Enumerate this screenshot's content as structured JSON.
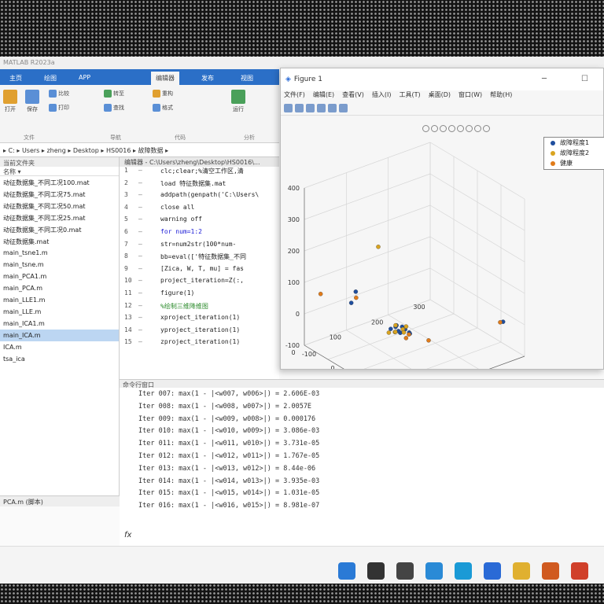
{
  "matlab": {
    "title": "MATLAB R2023a",
    "ribbon_tabs": [
      "主页",
      "绘图",
      "APP",
      "编辑器",
      "发布",
      "视图"
    ],
    "ribbon": {
      "open": "打开",
      "save": "保存",
      "compare": "比较",
      "print": "打印",
      "go_to": "转至",
      "find": "查找",
      "refactor": "重构",
      "format": "格式",
      "run": "运行",
      "section_file": "文件",
      "section_nav": "导航",
      "section_code": "代码",
      "section_analyze": "分析"
    },
    "address": "▸ C: ▸ Users ▸ zheng ▸ Desktop ▸ HS0016 ▸ 故障数据 ▸"
  },
  "filebrowser": {
    "header": "当前文件夹",
    "column": "名称 ▾",
    "items": [
      "动征数据集_不同工况100.mat",
      "动征数据集_不同工况75.mat",
      "动征数据集_不同工况50.mat",
      "动征数据集_不同工况25.mat",
      "动征数据集_不同工况0.mat",
      "动征数据集.mat",
      "main_tsne1.m",
      "main_tsne.m",
      "main_PCA1.m",
      "main_PCA.m",
      "main_LLE1.m",
      "main_LLE.m",
      "main_ICA1.m",
      "main_ICA.m",
      "ICA.m",
      "tsa_ica"
    ],
    "selected_index": 13,
    "details": "PCA.m (脚本)"
  },
  "editor": {
    "tab": "编辑器 - C:\\Users\\zheng\\Desktop\\HS0016\\...",
    "lines": [
      {
        "n": "1",
        "code": "clc;clear;%清空工作区,清",
        "cls": "",
        "mark": "—"
      },
      {
        "n": "2",
        "code": "load 特征数据集.mat",
        "cls": "",
        "mark": "—"
      },
      {
        "n": "3",
        "code": "addpath(genpath('C:\\Users\\",
        "cls": "",
        "mark": "—"
      },
      {
        "n": "4",
        "code": "close all",
        "cls": "",
        "mark": "—"
      },
      {
        "n": "5",
        "code": "warning off",
        "cls": "",
        "mark": "—"
      },
      {
        "n": "6",
        "code": "for num=1:2",
        "cls": "kw",
        "mark": "—"
      },
      {
        "n": "7",
        "code": "  str=num2str(100*num-",
        "cls": "",
        "mark": "—"
      },
      {
        "n": "8",
        "code": "  bb=eval(['特征数据集_不同",
        "cls": "",
        "mark": "—"
      },
      {
        "n": "9",
        "code": "  [Zica, W, T, mu] = fas",
        "cls": "",
        "mark": "—"
      },
      {
        "n": "10",
        "code": "  project_iteration=Z(:,",
        "cls": "",
        "mark": "—"
      },
      {
        "n": "11",
        "code": "  figure(1)",
        "cls": "",
        "mark": "—"
      },
      {
        "n": "12",
        "code": "  %绘制三维降维图",
        "cls": "cmt",
        "mark": "—"
      },
      {
        "n": "13",
        "code": "  xproject_iteration(1)",
        "cls": "",
        "mark": "—"
      },
      {
        "n": "14",
        "code": "  yproject_iteration(1)",
        "cls": "",
        "mark": "—"
      },
      {
        "n": "15",
        "code": "  zproject_iteration(1)",
        "cls": "",
        "mark": "—"
      }
    ]
  },
  "cmdwin": {
    "header": "命令行窗口",
    "lines": [
      "Iter 007: max(1 - |<w007, w006>|) = 2.606E-03",
      "Iter 008: max(1 - |<w008, w007>|) = 2.0057E",
      "Iter 009: max(1 - |<w009, w008>|) = 0.000176",
      "Iter 010: max(1 - |<w010, w009>|) = 3.086e-03",
      "Iter 011: max(1 - |<w011, w010>|) = 3.731e-05",
      "Iter 012: max(1 - |<w012, w011>|) = 1.767e-05",
      "Iter 013: max(1 - |<w013, w012>|) = 8.44e-06",
      "Iter 014: max(1 - |<w014, w013>|) = 3.935e-03",
      "Iter 015: max(1 - |<w015, w014>|) = 1.031e-05",
      "Iter 016: max(1 - |<w016, w015>|) = 8.981e-07"
    ],
    "prompt": "fx"
  },
  "figure": {
    "title": "Figure 1",
    "menu": [
      "文件(F)",
      "编辑(E)",
      "查看(V)",
      "插入(I)",
      "工具(T)",
      "桌面(D)",
      "窗口(W)",
      "帮助(H)"
    ],
    "legend": [
      {
        "label": "故障程度1",
        "color": "#1f4e9e"
      },
      {
        "label": "故障程度2",
        "color": "#d9a420"
      },
      {
        "label": "健康",
        "color": "#e07b1a"
      }
    ]
  },
  "chart_data": {
    "type": "scatter",
    "title": "",
    "z_ticks": [
      "-100",
      "0",
      "100",
      "200",
      "300",
      "400"
    ],
    "x_ticks": [
      "-100",
      "0",
      "100",
      "200",
      "300"
    ],
    "y_ticks": [
      "0",
      "100",
      "200",
      "300"
    ],
    "series": [
      {
        "name": "故障程度1",
        "color": "#1f4e9e",
        "points": [
          [
            -60,
            200,
            40
          ],
          [
            10,
            250,
            60
          ],
          [
            20,
            150,
            -60
          ],
          [
            30,
            140,
            -60
          ],
          [
            40,
            150,
            -70
          ],
          [
            50,
            160,
            -55
          ],
          [
            60,
            140,
            -65
          ],
          [
            25,
            130,
            -75
          ],
          [
            35,
            170,
            -50
          ],
          [
            45,
            130,
            -80
          ],
          [
            280,
            40,
            20
          ],
          [
            15,
            145,
            -60
          ]
        ]
      },
      {
        "name": "故障程度2",
        "color": "#d9a420",
        "points": [
          [
            0,
            180,
            200
          ],
          [
            20,
            150,
            -55
          ],
          [
            35,
            160,
            -65
          ],
          [
            28,
            155,
            -70
          ],
          [
            42,
            145,
            -60
          ],
          [
            18,
            165,
            -72
          ],
          [
            38,
            135,
            -58
          ],
          [
            55,
            150,
            -62
          ]
        ]
      },
      {
        "name": "健康",
        "color": "#e07b1a",
        "points": [
          [
            -120,
            250,
            30
          ],
          [
            -5,
            230,
            60
          ],
          [
            130,
            180,
            -20
          ],
          [
            160,
            150,
            -40
          ],
          [
            250,
            30,
            0
          ],
          [
            100,
            170,
            -50
          ]
        ]
      }
    ]
  },
  "taskbar": {
    "icons": [
      {
        "name": "start-icon",
        "color": "#2a7ad6"
      },
      {
        "name": "search-icon",
        "color": "#333333"
      },
      {
        "name": "taskview-icon",
        "color": "#444444"
      },
      {
        "name": "browser-icon",
        "color": "#2a8ad6"
      },
      {
        "name": "edge-icon",
        "color": "#1a9ad6"
      },
      {
        "name": "store-icon",
        "color": "#2a6ad6"
      },
      {
        "name": "explorer-icon",
        "color": "#e0b030"
      },
      {
        "name": "matlab-icon",
        "color": "#d05a20"
      },
      {
        "name": "app-icon",
        "color": "#d0402a"
      }
    ]
  }
}
